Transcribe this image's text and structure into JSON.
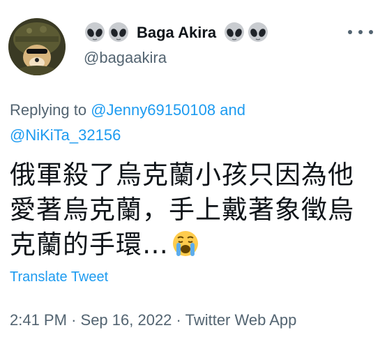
{
  "author": {
    "display_name": "Baga Akira",
    "name_emoji_left": [
      "alien-icon",
      "alien-icon"
    ],
    "name_emoji_right": [
      "alien-icon",
      "alien-icon"
    ],
    "handle": "@bagaakira"
  },
  "reply": {
    "prefix": "Replying to",
    "user1": "@Jenny69150108",
    "conjunction": "and",
    "user2": "@NiKiTa_32156"
  },
  "tweet": {
    "line1": "俄軍殺了烏克蘭小孩只因為他",
    "line2": "愛著烏克蘭，手上戴著象徵烏",
    "line3": "克蘭的手環…",
    "emoji": "loudly-crying-face-icon"
  },
  "translate_label": "Translate Tweet",
  "meta": {
    "time": "2:41 PM",
    "sep1": "·",
    "date": "Sep 16, 2022",
    "sep2": "·",
    "source": "Twitter Web App"
  },
  "colors": {
    "text": "#0f1419",
    "secondary": "#536471",
    "link": "#1d9bf0"
  }
}
